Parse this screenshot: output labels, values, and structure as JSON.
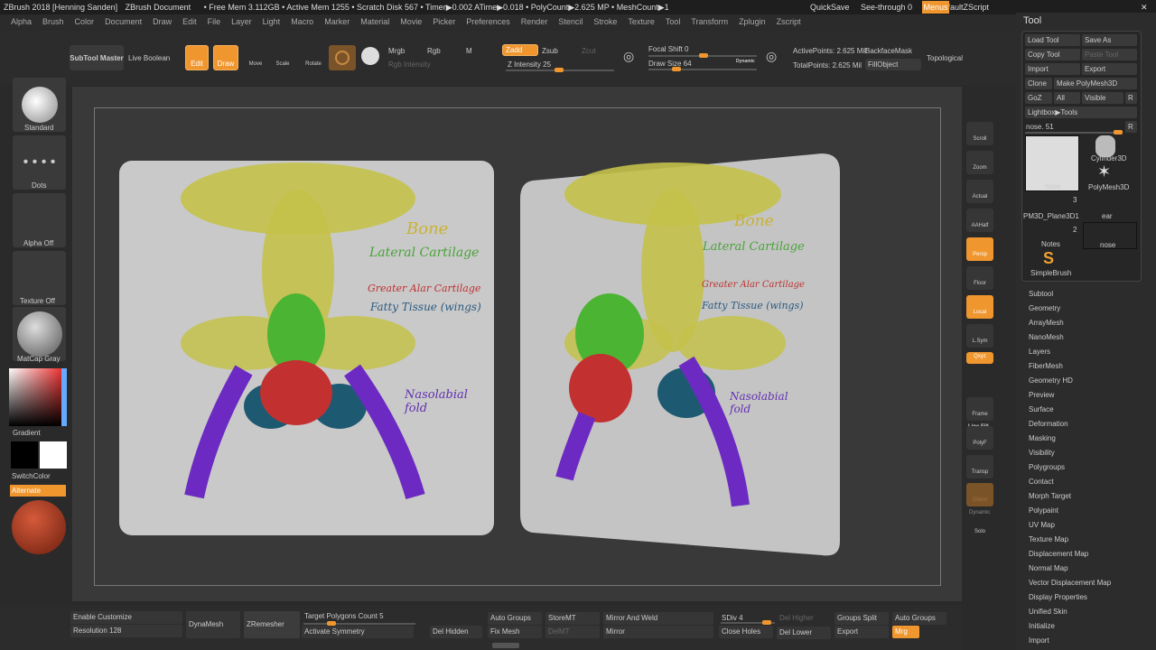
{
  "titlebar": {
    "app": "ZBrush 2018 [Henning Sanden]",
    "doc": "ZBrush Document",
    "stats": "• Free Mem 3.112GB • Active Mem 1255 • Scratch Disk 567 • Timer▶0.002 ATime▶0.018 • PolyCount▶2.625 MP • MeshCount▶1",
    "quicksave": "QuickSave",
    "seethrough": "See-through 0",
    "menus": "Menus",
    "script": "DefaultZScript"
  },
  "menu": [
    "Alpha",
    "Brush",
    "Color",
    "Document",
    "Draw",
    "Edit",
    "File",
    "Layer",
    "Light",
    "Macro",
    "Marker",
    "Material",
    "Movie",
    "Picker",
    "Preferences",
    "Render",
    "Stencil",
    "Stroke",
    "Texture",
    "Tool",
    "Transform",
    "Zplugin",
    "Zscript"
  ],
  "toolbar": {
    "subtool_master": "SubTool Master",
    "live_boolean": "Live Boolean",
    "edit": "Edit",
    "draw": "Draw",
    "move": "Move",
    "scale": "Scale",
    "rotate": "Rotate",
    "mrgb": "Mrgb",
    "rgb": "Rgb",
    "m": "M",
    "rgb_intensity": "Rgb Intensity",
    "zadd": "Zadd",
    "zsub": "Zsub",
    "zcut": "Zcut",
    "z_intensity": "Z Intensity 25",
    "z_intensity_value": 25,
    "focal_shift": "Focal Shift 0",
    "draw_size": "Draw Size 64",
    "draw_size_value": 64,
    "dynamic": "Dynamic",
    "active_points": "ActivePoints: 2.625 Mil",
    "backface": "BackfaceMask",
    "total_points": "TotalPoints: 2.625 Mil",
    "fill_object": "FillObject",
    "topological": "Topological",
    "accent": "#f0962e"
  },
  "leftshelf": {
    "brush": "Standard",
    "stroke": "Dots",
    "alpha": "Alpha Off",
    "texture": "Texture Off",
    "material": "MatCap Gray",
    "gradient": "Gradient",
    "switch_color": "SwitchColor",
    "alternate": "Alternate"
  },
  "canvas": {
    "notes": [
      "Bone",
      "Lateral Cartilage",
      "Greater Alar Cartilage",
      "Fatty Tissue (wings)",
      "Nasolabial fold"
    ]
  },
  "rightshelf": [
    "Scroll",
    "Zoom",
    "Actual",
    "AAHalf",
    "Persp",
    "Floor",
    "Local",
    "L.Sym",
    "Qxyz",
    "Frame",
    "PolyF",
    "Transp",
    "Ghost",
    "Solo"
  ],
  "rightshelf_extra": {
    "line_fill": "Line Fill",
    "dynamic": "Dynamic"
  },
  "tool": {
    "title": "Tool",
    "load": "Load Tool",
    "save_as": "Save As",
    "copy": "Copy Tool",
    "paste": "Paste Tool",
    "import": "Import",
    "export": "Export",
    "clone": "Clone",
    "make_polymesh": "Make PolyMesh3D",
    "goz": "GoZ",
    "all": "All",
    "visible": "Visible",
    "r": "R",
    "lightbox": "Lightbox▶Tools",
    "current": "nose. 51",
    "thumbs": [
      {
        "name": "nose"
      },
      {
        "name": "Cylinder3D"
      },
      {
        "name": "PolyMesh3D"
      },
      {
        "name": "PM3D_Plane3D1",
        "count": "3"
      },
      {
        "name": "ear"
      },
      {
        "name": "Notes",
        "count": "2"
      },
      {
        "name": "nose"
      },
      {
        "name": "SimpleBrush"
      }
    ],
    "menu": [
      "Subtool",
      "Geometry",
      "ArrayMesh",
      "NanoMesh",
      "Layers",
      "FiberMesh",
      "Geometry HD",
      "Preview",
      "Surface",
      "Deformation",
      "Masking",
      "Visibility",
      "Polygroups",
      "Contact",
      "Morph Target",
      "Polypaint",
      "UV Map",
      "Texture Map",
      "Displacement Map",
      "Normal Map",
      "Vector Displacement Map",
      "Display Properties",
      "Unified Skin",
      "Initialize",
      "Import"
    ]
  },
  "bottom": {
    "enable_customize": "Enable Customize",
    "resolution": "Resolution 128",
    "dynamesh": "DynaMesh",
    "zremesher": "ZRemesher",
    "target_poly": "Target Polygons Count 5",
    "activate_symmetry": "Activate Symmetry",
    "del_hidden": "Del Hidden",
    "auto_groups": "Auto Groups",
    "fix_mesh": "Fix Mesh",
    "storemt": "StoreMT",
    "delmt": "DelMT",
    "mirror_weld": "Mirror And Weld",
    "mirror": "Mirror",
    "sdiv": "SDiv 4",
    "close_holes": "Close Holes",
    "del_higher": "Del Higher",
    "del_lower": "Del Lower",
    "groups_split": "Groups Split",
    "export": "Export",
    "auto_groups2": "Auto Groups",
    "mrg": "Mrg"
  }
}
